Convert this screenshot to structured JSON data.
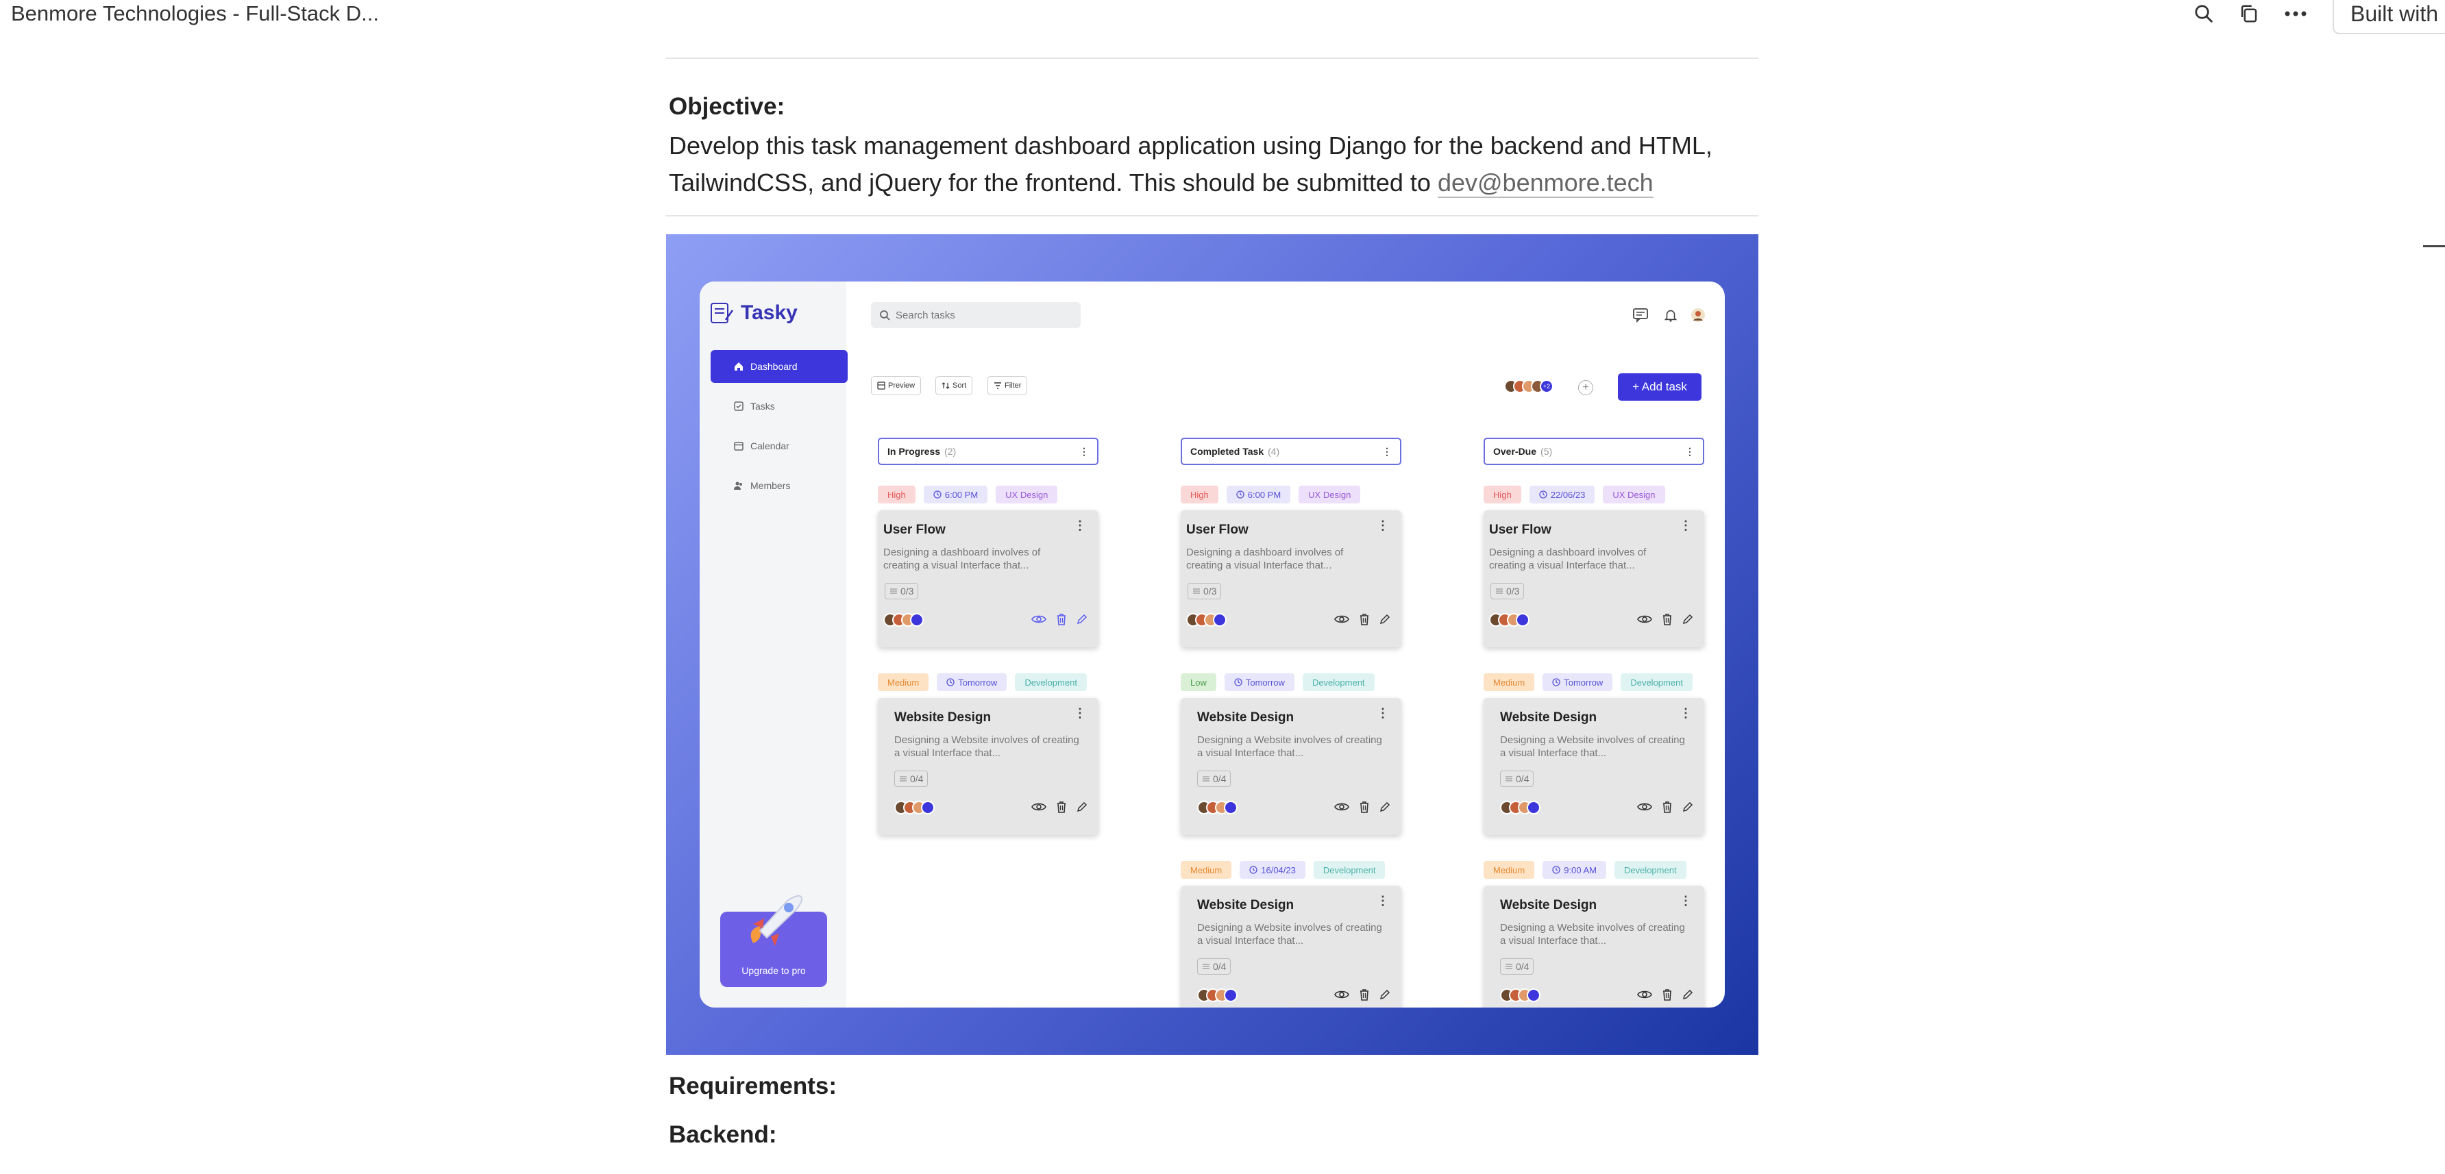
{
  "topbar": {
    "doc_title": "Benmore Technologies - Full-Stack D...",
    "built_label": "Built with"
  },
  "doc": {
    "objective_heading": "Objective:",
    "objective_text": "Develop this task management dashboard application using Django for the backend and HTML, TailwindCSS, and jQuery for the frontend. This should be submitted to ",
    "objective_link": "dev@benmore.tech",
    "requirements_heading": "Requirements:",
    "backend_heading": "Backend:"
  },
  "app": {
    "logo": "Tasky",
    "nav": [
      {
        "label": "Dashboard",
        "icon": "home-icon",
        "active": true
      },
      {
        "label": "Tasks",
        "icon": "tasks-icon",
        "active": false
      },
      {
        "label": "Calendar",
        "icon": "calendar-icon",
        "active": false
      },
      {
        "label": "Members",
        "icon": "members-icon",
        "active": false
      }
    ],
    "upgrade_label": "Upgrade to pro",
    "search_placeholder": "Search tasks",
    "toolbar": {
      "preview": "Preview",
      "sort": "Sort",
      "filter": "Filter"
    },
    "add_task_label": "+ Add task",
    "team_overflow": "+2",
    "columns": [
      {
        "title": "In Progress",
        "count": "(2)"
      },
      {
        "title": "Completed Task",
        "count": "(4)"
      },
      {
        "title": "Over-Due",
        "count": "(5)"
      }
    ],
    "cards": [
      {
        "col": 0,
        "row": 0,
        "priority": "High",
        "pclass": "t-high",
        "time": "6:00 PM",
        "category": "UX Design",
        "cclass": "t-ux",
        "title": "User Flow",
        "desc": "Designing a dashboard involves of creating a visual Interface that...",
        "progress": "0/3"
      },
      {
        "col": 1,
        "row": 0,
        "priority": "High",
        "pclass": "t-high",
        "time": "6:00 PM",
        "category": "UX Design",
        "cclass": "t-ux",
        "title": "User Flow",
        "desc": "Designing a dashboard involves of creating a visual Interface that...",
        "progress": "0/3"
      },
      {
        "col": 2,
        "row": 0,
        "priority": "High",
        "pclass": "t-high",
        "time": "22/06/23",
        "category": "UX Design",
        "cclass": "t-ux",
        "title": "User Flow",
        "desc": "Designing a dashboard involves of creating a visual Interface that...",
        "progress": "0/3"
      },
      {
        "col": 0,
        "row": 1,
        "priority": "Medium",
        "pclass": "t-medium",
        "time": "Tomorrow",
        "category": "Development",
        "cclass": "t-dev",
        "title": "Website Design",
        "desc": "Designing a Website involves of creating a visual Interface that...",
        "progress": "0/4"
      },
      {
        "col": 1,
        "row": 1,
        "priority": "Low",
        "pclass": "t-low",
        "time": "Tomorrow",
        "category": "Development",
        "cclass": "t-dev",
        "title": "Website Design",
        "desc": "Designing a Website involves of creating a visual Interface that...",
        "progress": "0/4"
      },
      {
        "col": 2,
        "row": 1,
        "priority": "Medium",
        "pclass": "t-medium",
        "time": "Tomorrow",
        "category": "Development",
        "cclass": "t-dev",
        "title": "Website Design",
        "desc": "Designing a Website involves of creating a visual Interface that...",
        "progress": "0/4"
      },
      {
        "col": 1,
        "row": 2,
        "priority": "Medium",
        "pclass": "t-medium",
        "time": "16/04/23",
        "category": "Development",
        "cclass": "t-dev",
        "title": "Website Design",
        "desc": "Designing a Website involves of creating a visual Interface that...",
        "progress": "0/4"
      },
      {
        "col": 2,
        "row": 2,
        "priority": "Medium",
        "pclass": "t-medium",
        "time": "9:00 AM",
        "category": "Development",
        "cclass": "t-dev",
        "title": "Website Design",
        "desc": "Designing a Website involves of creating a visual Interface that...",
        "progress": "0/4"
      }
    ]
  },
  "colors": {
    "accent": "#3c36dc",
    "hero_gradient": [
      "#8f9ef4",
      "#5466d6",
      "#1b36a3"
    ],
    "avatar_colors": [
      "#6b4a2f",
      "#c6603a",
      "#e09a6a",
      "#3c36dc"
    ]
  }
}
